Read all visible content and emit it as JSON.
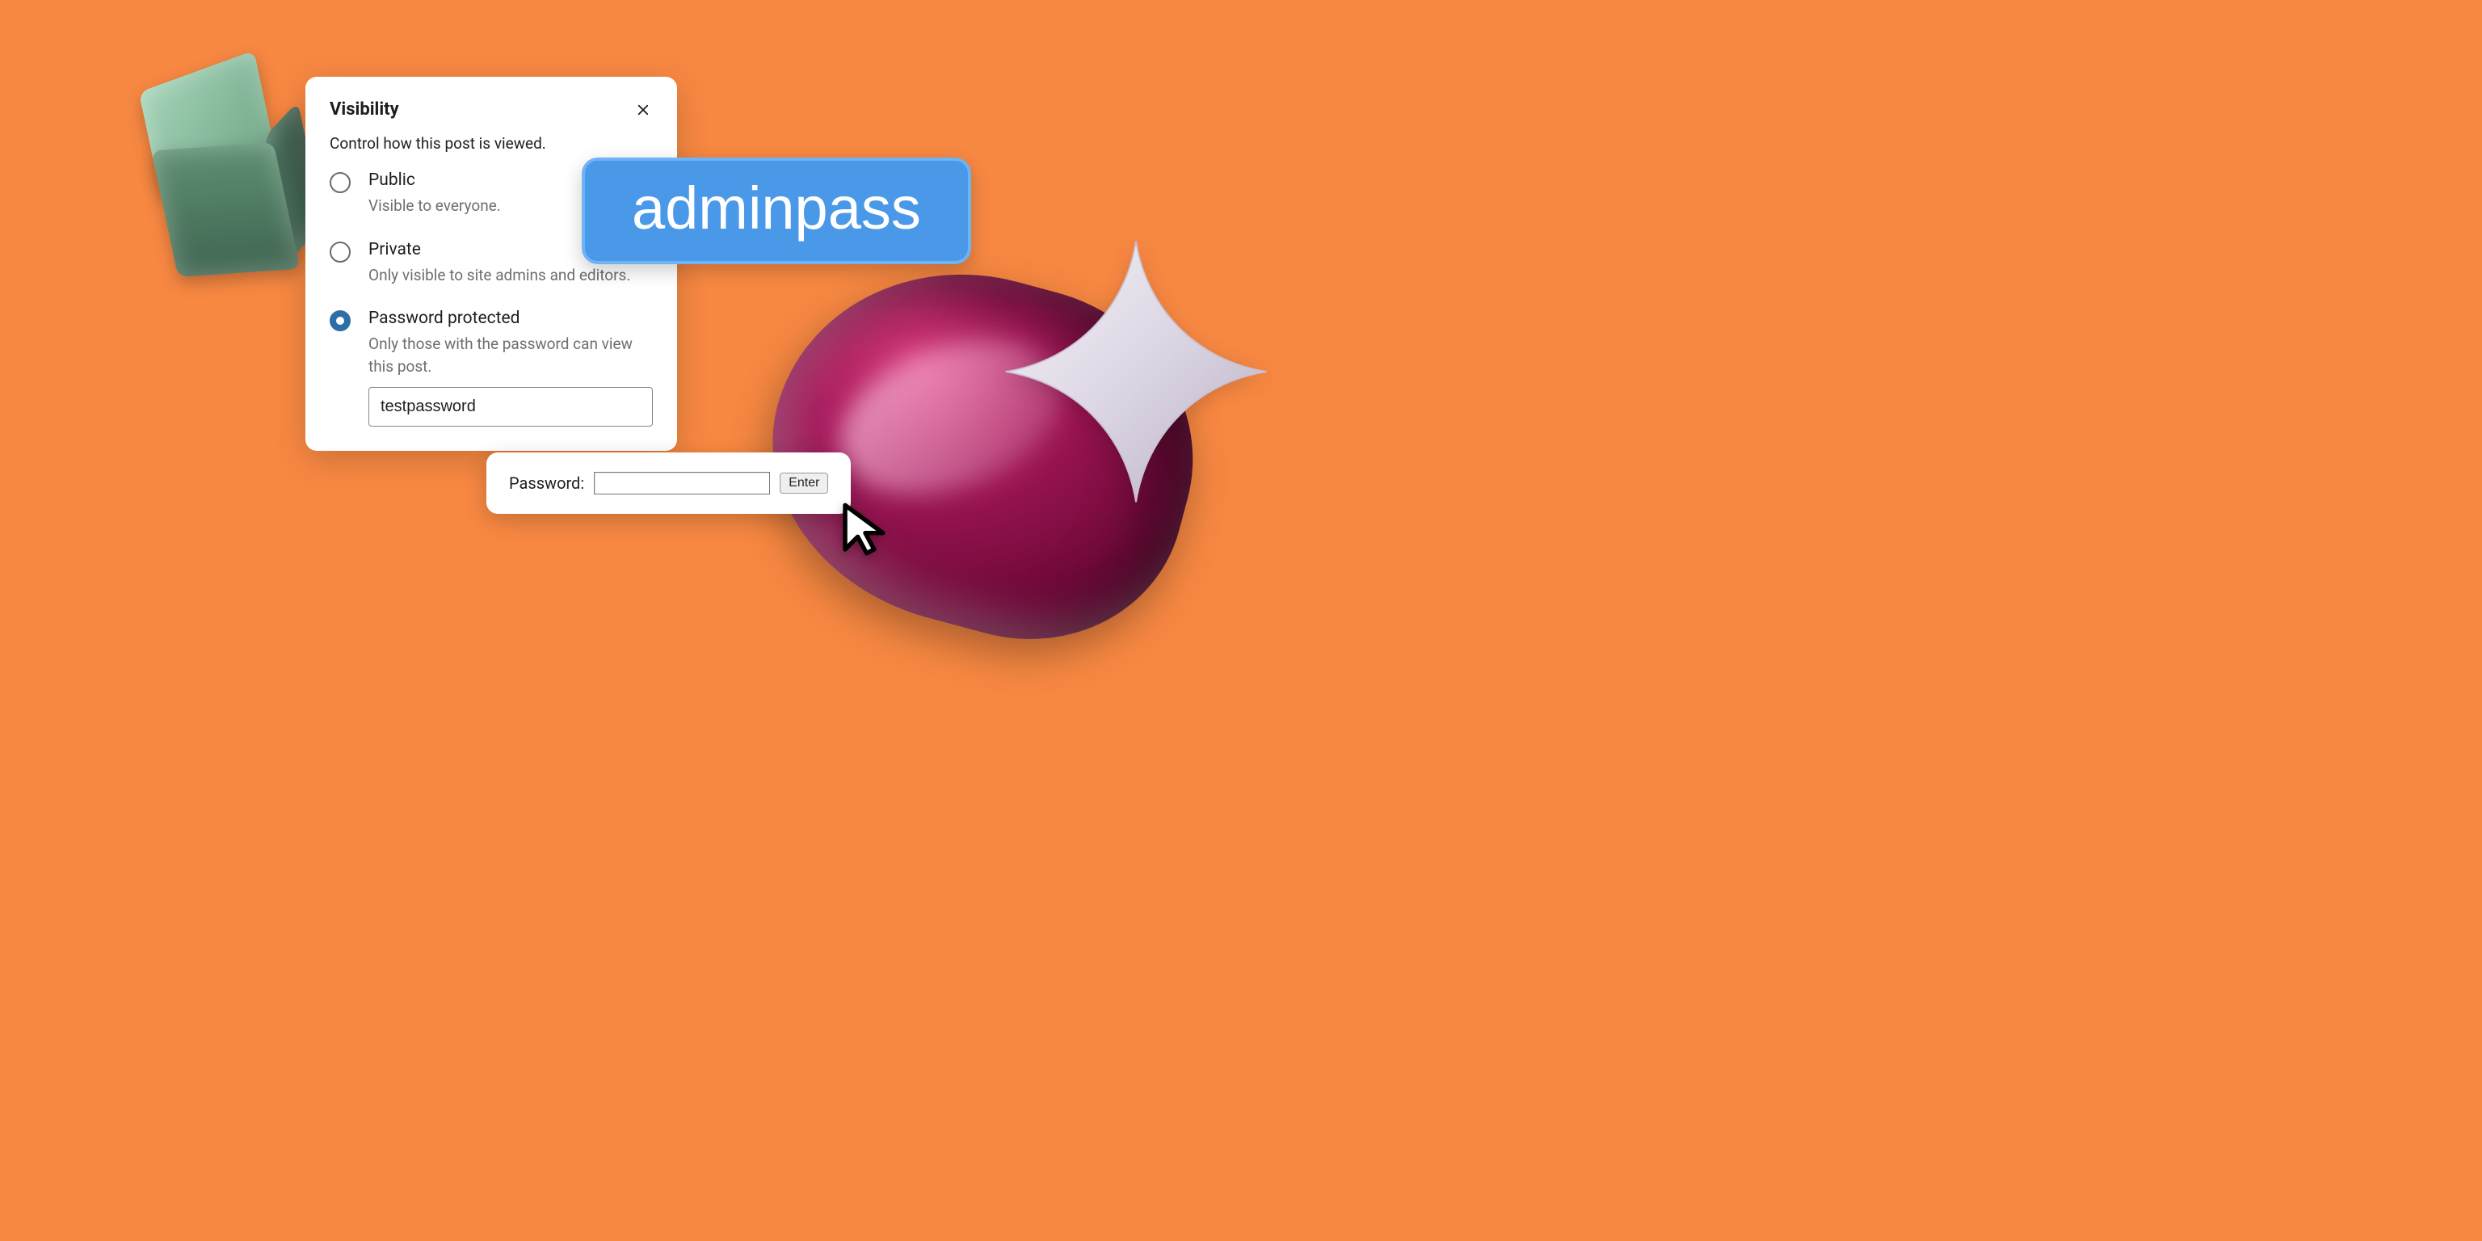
{
  "visibility": {
    "title": "Visibility",
    "subtitle": "Control how this post is viewed.",
    "options": [
      {
        "label": "Public",
        "desc": "Visible to everyone."
      },
      {
        "label": "Private",
        "desc": "Only visible to site admins and editors."
      },
      {
        "label": "Password protected",
        "desc": "Only those with the password can view this post."
      }
    ],
    "password_value": "testpassword"
  },
  "adminpass_label": "adminpass",
  "prompt": {
    "label": "Password:",
    "input_value": "",
    "enter_label": "Enter"
  }
}
